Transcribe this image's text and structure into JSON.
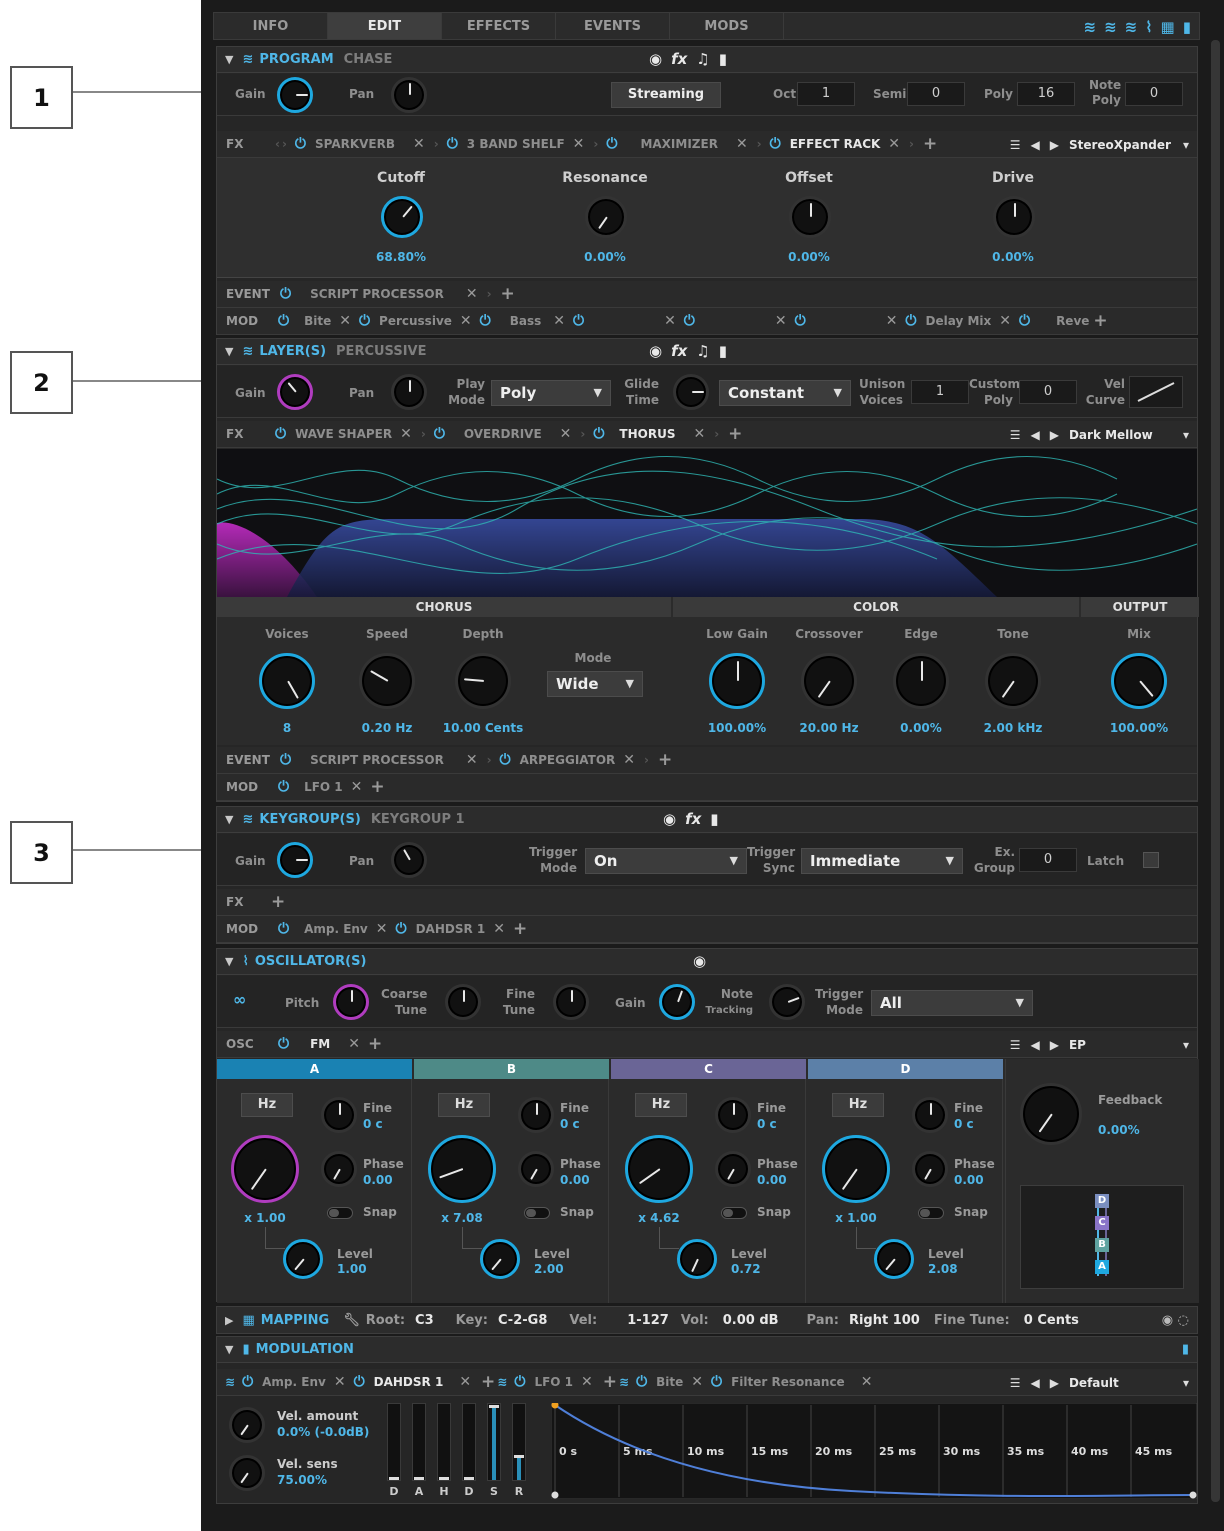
{
  "callouts": [
    "1",
    "2",
    "3"
  ],
  "tabs": [
    "INFO",
    "EDIT",
    "EFFECTS",
    "EVENTS",
    "MODS"
  ],
  "tab_icons": [
    "layers-icon",
    "layers-icon",
    "layers-icon",
    "waveform-icon",
    "grid-icon",
    "bars-icon"
  ],
  "program": {
    "title": "PROGRAM",
    "name": "CHASE",
    "gain_label": "Gain",
    "pan_label": "Pan",
    "streaming": "Streaming",
    "oct_label": "Oct",
    "oct": "1",
    "semi_label": "Semi",
    "semi": "0",
    "poly_label": "Poly",
    "poly": "16",
    "notepoly_label1": "Note",
    "notepoly_label2": "Poly",
    "notepoly": "0",
    "fx_label": "FX",
    "fx": [
      "SPARKVERB",
      "3 BAND SHELF",
      "MAXIMIZER",
      "EFFECT RACK"
    ],
    "preset": "StereoXpander",
    "params": [
      {
        "label": "Cutoff",
        "value": "68.80%"
      },
      {
        "label": "Resonance",
        "value": "0.00%"
      },
      {
        "label": "Offset",
        "value": "0.00%"
      },
      {
        "label": "Drive",
        "value": "0.00%"
      }
    ],
    "event_label": "EVENT",
    "event": "SCRIPT PROCESSOR",
    "mod_label": "MOD",
    "mods": [
      "Bite",
      "Percussive",
      "Bass",
      "",
      "",
      "",
      "Delay Mix",
      "Reve"
    ]
  },
  "layer": {
    "title": "LAYER(S)",
    "name": "PERCUSSIVE",
    "gain_label": "Gain",
    "pan_label": "Pan",
    "playmode_label1": "Play",
    "playmode_label2": "Mode",
    "playmode": "Poly",
    "glide_label1": "Glide",
    "glide_label2": "Time",
    "glide_mode": "Constant",
    "unison_label1": "Unison",
    "unison_label2": "Voices",
    "unison": "1",
    "custompoly_label1": "Custom",
    "custompoly_label2": "Poly",
    "custompoly": "0",
    "velcurve_label1": "Vel",
    "velcurve_label2": "Curve",
    "fx_label": "FX",
    "fx": [
      "WAVE SHAPER",
      "OVERDRIVE",
      "THORUS"
    ],
    "preset": "Dark Mellow",
    "sections": [
      "CHORUS",
      "COLOR",
      "OUTPUT"
    ],
    "chorus": [
      {
        "label": "Voices",
        "value": "8"
      },
      {
        "label": "Speed",
        "value": "0.20 Hz"
      },
      {
        "label": "Depth",
        "value": "10.00 Cents"
      }
    ],
    "mode_label": "Mode",
    "mode": "Wide",
    "color": [
      {
        "label": "Low Gain",
        "value": "100.00%"
      },
      {
        "label": "Crossover",
        "value": "20.00 Hz"
      },
      {
        "label": "Edge",
        "value": "0.00%"
      },
      {
        "label": "Tone",
        "value": "2.00 kHz"
      }
    ],
    "output": [
      {
        "label": "Mix",
        "value": "100.00%"
      }
    ],
    "event_label": "EVENT",
    "events": [
      "SCRIPT PROCESSOR",
      "ARPEGGIATOR"
    ],
    "mod_label": "MOD",
    "mods": [
      "LFO 1"
    ]
  },
  "keygroup": {
    "title": "KEYGROUP(S)",
    "name": "KEYGROUP 1",
    "gain_label": "Gain",
    "pan_label": "Pan",
    "trigmode_label1": "Trigger",
    "trigmode_label2": "Mode",
    "trigmode": "On",
    "trigsync_label1": "Trigger",
    "trigsync_label2": "Sync",
    "trigsync": "Immediate",
    "exgroup_label1": "Ex.",
    "exgroup_label2": "Group",
    "exgroup": "0",
    "latch_label": "Latch",
    "fx_label": "FX",
    "mod_label": "MOD",
    "mods": [
      "Amp. Env",
      "DAHDSR 1"
    ]
  },
  "oscillator": {
    "title": "OSCILLATOR(S)",
    "pitch_label": "Pitch",
    "coarse_label1": "Coarse",
    "coarse_label2": "Tune",
    "fine_label1": "Fine",
    "fine_label2": "Tune",
    "gain_label": "Gain",
    "note_label1": "Note",
    "note_label2": "Tracking",
    "trigmode_label1": "Trigger",
    "trigmode_label2": "Mode",
    "trigmode": "All",
    "osc_label": "OSC",
    "osc": "FM",
    "preset": "EP",
    "ops": [
      {
        "name": "A",
        "color": "#1a82b3",
        "hz": "Hz",
        "fine": "0 c",
        "phase": "0.00",
        "ratio": "x 1.00",
        "level": "1.00"
      },
      {
        "name": "B",
        "color": "#4e8a87",
        "hz": "Hz",
        "fine": "0 c",
        "phase": "0.00",
        "ratio": "x 7.08",
        "level": "2.00"
      },
      {
        "name": "C",
        "color": "#6a6596",
        "hz": "Hz",
        "fine": "0 c",
        "phase": "0.00",
        "ratio": "x 4.62",
        "level": "0.72"
      },
      {
        "name": "D",
        "color": "#5c80a8",
        "hz": "Hz",
        "fine": "0 c",
        "phase": "0.00",
        "ratio": "x 1.00",
        "level": "2.08"
      }
    ],
    "fine_lbl": "Fine",
    "phase_lbl": "Phase",
    "snap_lbl": "Snap",
    "level_lbl": "Level",
    "feedback_label": "Feedback",
    "feedback": "0.00%",
    "algo": [
      "D",
      "C",
      "B",
      "A"
    ]
  },
  "mapping": {
    "title": "MAPPING",
    "root_label": "Root:",
    "root": "C3",
    "key_label": "Key:",
    "key": "C-2-G8",
    "vel_label": "Vel:",
    "vel": "1-127",
    "vol_label": "Vol:",
    "vol": "0.00 dB",
    "pan_label": "Pan:",
    "pan": "Right 100",
    "finetune_label": "Fine Tune:",
    "finetune": "0 Cents"
  },
  "modulation": {
    "title": "MODULATION",
    "tabs": [
      "Amp. Env",
      "DAHDSR 1",
      "LFO 1",
      "Bite",
      "Filter Resonance"
    ],
    "preset": "Default",
    "velamount_label": "Vel. amount",
    "velamount": "0.0% (-0.0dB)",
    "velsens_label": "Vel. sens",
    "velsens": "75.00%",
    "sliders": [
      "D",
      "A",
      "H",
      "D",
      "S",
      "R"
    ],
    "slider_levels": [
      0,
      0,
      0,
      0,
      1,
      0.3
    ],
    "time_labels": [
      "0 s",
      "5 ms",
      "10 ms",
      "15 ms",
      "20 ms",
      "25 ms",
      "30 ms",
      "35 ms",
      "40 ms",
      "45 ms"
    ]
  }
}
